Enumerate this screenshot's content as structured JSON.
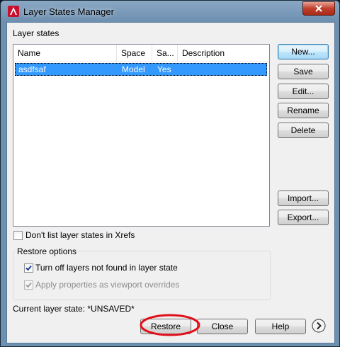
{
  "window": {
    "title": "Layer States Manager"
  },
  "layer_states": {
    "label": "Layer states",
    "columns": [
      "Name",
      "Space",
      "Sa...",
      "Description"
    ],
    "rows": [
      {
        "name": "asdfsaf",
        "space": "Model",
        "saved": "Yes",
        "description": ""
      }
    ]
  },
  "side_buttons": {
    "new": "New...",
    "save": "Save",
    "edit": "Edit...",
    "rename": "Rename",
    "delete": "Delete",
    "import": "Import...",
    "export": "Export..."
  },
  "dont_list_xrefs": {
    "label": "Don't list layer states in Xrefs",
    "checked": false
  },
  "restore_options": {
    "label": "Restore options",
    "turn_off_layers": {
      "label": "Turn off layers not found in layer state",
      "checked": true
    },
    "apply_viewport": {
      "label": "Apply properties as viewport overrides",
      "checked": true,
      "disabled": true
    }
  },
  "current_state": {
    "text": "Current layer state: *UNSAVED*"
  },
  "bottom_buttons": {
    "restore": "Restore",
    "close": "Close",
    "help": "Help"
  },
  "colors": {
    "selection": "#3399ff",
    "highlight_ellipse": "#e0101a",
    "close_button": "#c0402c"
  },
  "icons": {
    "app": "autocad-icon",
    "close": "close-icon",
    "expand": "chevron-right-circle-icon",
    "check": "checkmark-icon"
  }
}
